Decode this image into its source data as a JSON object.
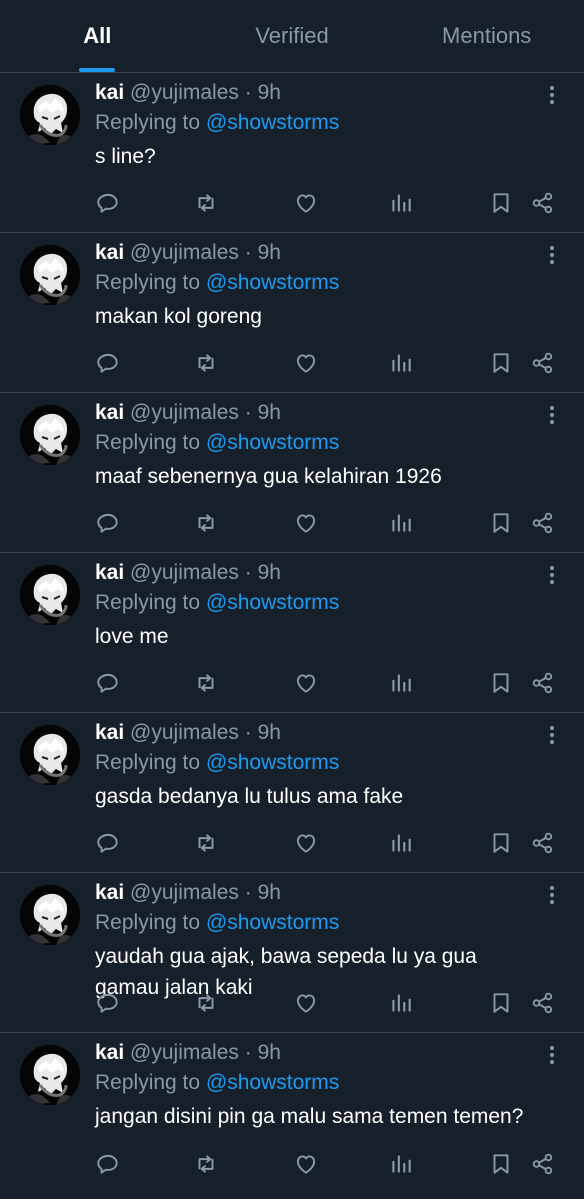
{
  "tabs": [
    {
      "label": "All",
      "active": true
    },
    {
      "label": "Verified",
      "active": false
    },
    {
      "label": "Mentions",
      "active": false
    }
  ],
  "colors": {
    "background": "#15202b",
    "accent": "#1d9bf0",
    "muted": "#8b98a5",
    "divider": "#38444d"
  },
  "icons": [
    "reply-icon",
    "retweet-icon",
    "like-icon",
    "views-icon",
    "bookmark-icon",
    "share-icon",
    "more-icon"
  ],
  "tweets": [
    {
      "name": "kai",
      "handle": "@yujimales",
      "dot": "·",
      "time": "9h",
      "replying_label": "Replying to",
      "mention": "@showstorms",
      "text": "s line?"
    },
    {
      "name": "kai",
      "handle": "@yujimales",
      "dot": "·",
      "time": "9h",
      "replying_label": "Replying to",
      "mention": "@showstorms",
      "text": "makan kol goreng"
    },
    {
      "name": "kai",
      "handle": "@yujimales",
      "dot": "·",
      "time": "9h",
      "replying_label": "Replying to",
      "mention": "@showstorms",
      "text": "maaf sebenernya gua kelahiran 1926"
    },
    {
      "name": "kai",
      "handle": "@yujimales",
      "dot": "·",
      "time": "9h",
      "replying_label": "Replying to",
      "mention": "@showstorms",
      "text": "love me"
    },
    {
      "name": "kai",
      "handle": "@yujimales",
      "dot": "·",
      "time": "9h",
      "replying_label": "Replying to",
      "mention": "@showstorms",
      "text": "gasda bedanya lu tulus ama fake"
    },
    {
      "name": "kai",
      "handle": "@yujimales",
      "dot": "·",
      "time": "9h",
      "replying_label": "Replying to",
      "mention": "@showstorms",
      "text": "yaudah gua ajak, bawa sepeda lu ya gua gamau jalan kaki"
    },
    {
      "name": "kai",
      "handle": "@yujimales",
      "dot": "·",
      "time": "9h",
      "replying_label": "Replying to",
      "mention": "@showstorms",
      "text": "jangan disini pin ga malu sama temen temen?"
    }
  ]
}
